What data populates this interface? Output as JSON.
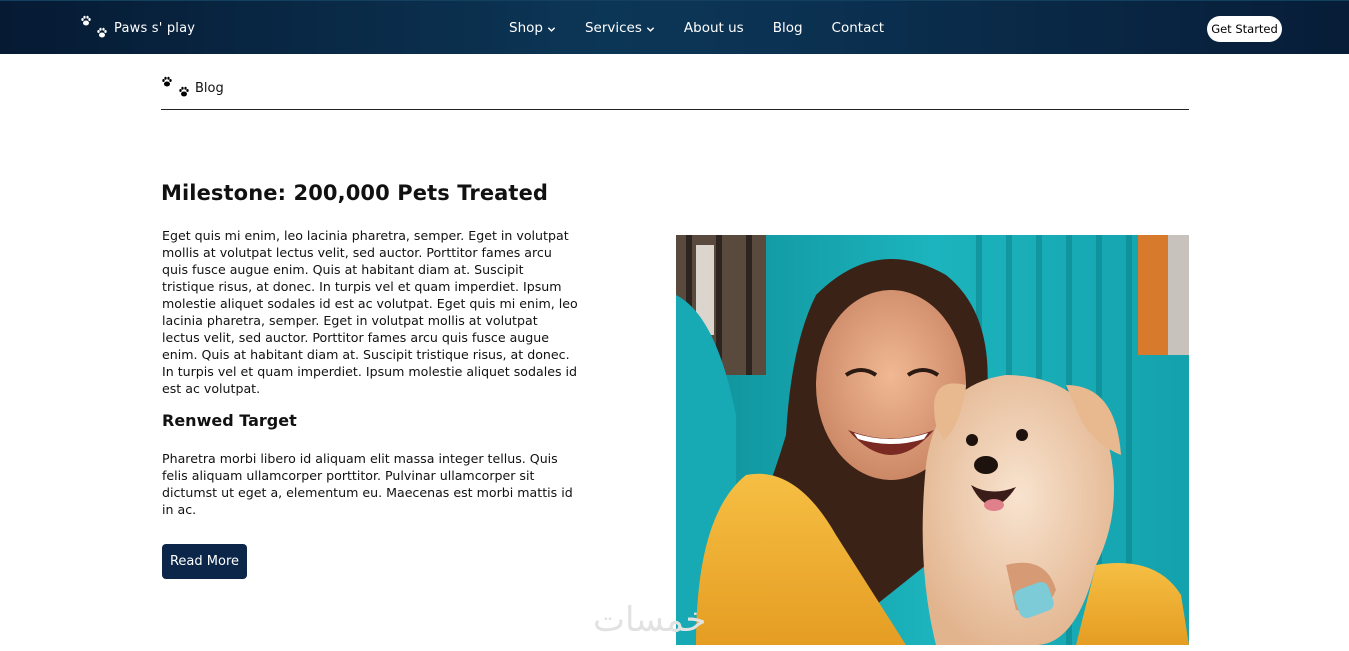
{
  "header": {
    "brand_name": "Paws s' play",
    "nav": {
      "shop": "Shop",
      "services": "Services",
      "about": "About us",
      "blog": "Blog",
      "contact": "Contact"
    },
    "cta_label": "Get Started"
  },
  "breadcrumb": {
    "label": "Blog"
  },
  "article": {
    "title": "Milestone: 200,000 Pets Treated",
    "body": "Eget quis mi enim, leo lacinia pharetra, semper. Eget in volutpat mollis at volutpat lectus velit, sed auctor. Porttitor fames arcu quis fusce augue enim. Quis at habitant diam at. Suscipit tristique risus, at donec. In turpis vel et quam imperdiet. Ipsum molestie aliquet sodales id est ac volutpat. Eget quis mi enim, leo lacinia pharetra, semper. Eget in volutpat mollis at volutpat lectus velit, sed auctor. Porttitor fames arcu quis fusce augue enim. Quis at habitant diam at. Suscipit tristique risus, at donec. In turpis vel et quam imperdiet. Ipsum molestie aliquet sodales id est ac volutpat.",
    "subheading": "Renwed Target",
    "body_2": "Pharetra morbi libero id aliquam elit massa integer tellus. Quis felis aliquam ullamcorper porttitor. Pulvinar ullamcorper sit dictumst ut eget a, elementum eu. Maecenas est morbi mattis id in ac.",
    "read_more_label": "Read More"
  },
  "watermark": "خمسات",
  "icons": {
    "brand_logo": "paw-prints-icon",
    "breadcrumb_icon": "paw-prints-icon",
    "dropdown": "chevron-down-icon"
  },
  "colors": {
    "header_bg": "#0c3656",
    "button_bg": "#0b2648",
    "accent_teal": "#1fb5c0",
    "shirt_yellow": "#f2b43a"
  }
}
